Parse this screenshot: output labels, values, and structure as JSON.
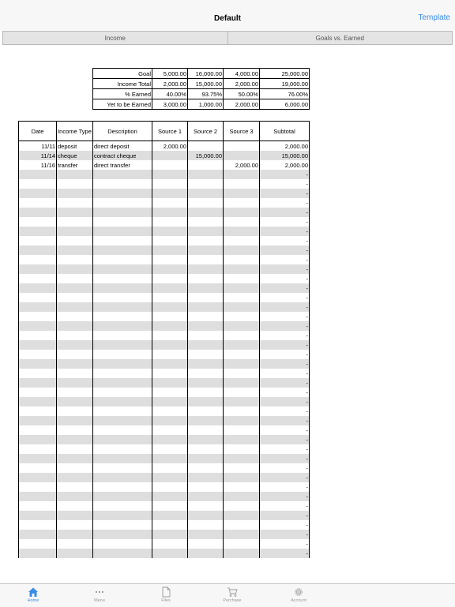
{
  "nav": {
    "title": "Default",
    "right_button": "Template"
  },
  "segments": [
    "Income",
    "Goals vs. Earned"
  ],
  "summary": [
    [
      "Goal",
      "5,000.00",
      "16,000.00",
      "4,000.00",
      "25,000.00"
    ],
    [
      "Income Total",
      "2,000.00",
      "15,000.00",
      "2,000.00",
      "19,000.00"
    ],
    [
      "% Earned",
      "40.00%",
      "93.75%",
      "50.00%",
      "76.00%"
    ],
    [
      "Yet to be Earned",
      "3,000.00",
      "1,000.00",
      "2,000.00",
      "6,000.00"
    ]
  ],
  "ledger": {
    "headers": [
      "Date",
      "Income Type",
      "Description",
      "Source 1",
      "Source 2",
      "Source 3",
      "Subtotal"
    ],
    "rows": [
      [
        "11/11",
        "deposit",
        "direct deposit",
        "2,000.00",
        "",
        "",
        "2,000.00"
      ],
      [
        "11/14",
        "cheque",
        "contract cheque",
        "",
        "15,000.00",
        "",
        "15,000.00"
      ],
      [
        "11/16",
        "transfer",
        "direct transfer",
        "",
        "",
        "2,000.00",
        "2,000.00"
      ]
    ],
    "empty_subtotal": "-"
  },
  "tabs": [
    {
      "label": "Home",
      "icon": "home-icon",
      "active": true
    },
    {
      "label": "Menu",
      "icon": "ellipsis-icon",
      "active": false
    },
    {
      "label": "Files",
      "icon": "file-icon",
      "active": false
    },
    {
      "label": "Purchase",
      "icon": "cart-icon",
      "active": false
    },
    {
      "label": "Account",
      "icon": "gear-icon",
      "active": false
    }
  ],
  "colors": {
    "accent": "#3a8ee6",
    "stripe": "#dedede"
  }
}
